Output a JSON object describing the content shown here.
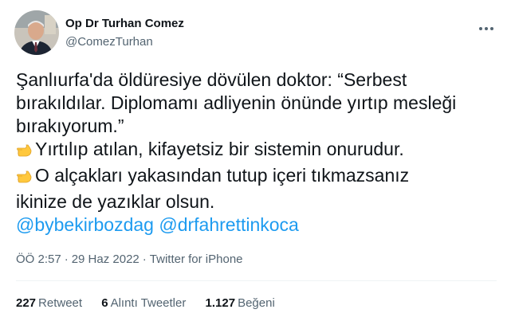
{
  "author": {
    "display_name": "Op Dr Turhan Comez",
    "handle": "@ComezTurhan",
    "avatar_icon": "profile-photo",
    "more_icon": "more-horizontal-icon"
  },
  "tweet": {
    "lines": [
      "Şanlıurfa'da öldüresiye dövülen doktor: “Serbest",
      "bırakıldılar. Diplomamı adliyenin önünde yırtıp mesleği",
      "bırakıyorum.”",
      "Yırtılıp atılan, kifayetsiz bir sistemin onurudur.",
      "O alçakları yakasından tutup içeri tıkmazsanız",
      "ikinize de yazıklar olsun."
    ],
    "emoji_icon": "backhand-index-pointing-right-icon",
    "mentions": [
      "@bybekirbozdag",
      "@drfahrettinkoca"
    ]
  },
  "meta": {
    "time": "ÖÖ 2:57",
    "separator": "·",
    "date": "29 Haz 2022",
    "source": "Twitter for iPhone"
  },
  "stats": {
    "retweets_count": "227",
    "retweets_label": "Retweet",
    "quotes_count": "6",
    "quotes_label": "Alıntı Tweetler",
    "likes_count": "1.127",
    "likes_label": "Beğeni"
  },
  "colors": {
    "text": "#0f1419",
    "secondary": "#536471",
    "link": "#1d9bf0",
    "divider": "#eff3f4",
    "emoji": "#ffc83d"
  }
}
